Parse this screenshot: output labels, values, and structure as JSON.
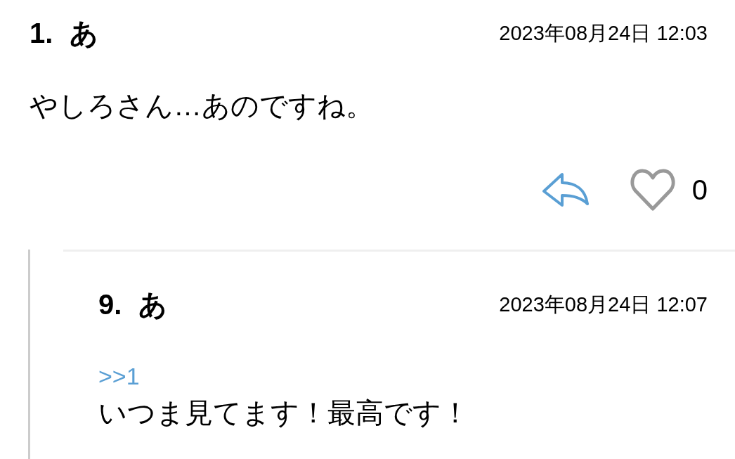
{
  "posts": [
    {
      "number": "1.",
      "name": "あ",
      "date": "2023年08月24日 12:03",
      "body": "やしろさん…あのですね。",
      "liked": false,
      "like_count": "0",
      "replies": [
        {
          "number": "9.",
          "name": "あ",
          "date": "2023年08月24日 12:07",
          "anchor": ">>1",
          "body": "いつま見てます！最高です！"
        }
      ]
    }
  ]
}
